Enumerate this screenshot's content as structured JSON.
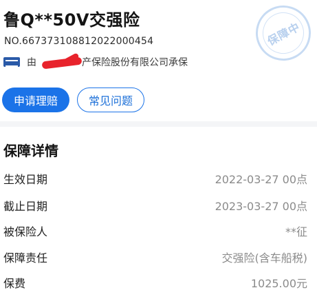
{
  "header": {
    "title": "鲁Q**50V交强险",
    "policy_number": "NO.667373108812022000454",
    "underwriter_prefix": "由",
    "underwriter_suffix": "产保险股份有限公司承保",
    "company_logo_icon": "insurer-logo-icon",
    "stamp_text": "保障中",
    "stamp_color": "#c7dbf3"
  },
  "actions": {
    "claim_label": "申请理赔",
    "faq_label": "常见问题",
    "accent_color": "#1b73e8"
  },
  "details": {
    "section_title": "保障详情",
    "rows": [
      {
        "label": "生效日期",
        "value": "2022-03-27 00点"
      },
      {
        "label": "截止日期",
        "value": "2023-03-27 00点"
      },
      {
        "label": "被保险人",
        "value": "**征"
      },
      {
        "label": "保障责任",
        "value": "交强险(含车船税)"
      },
      {
        "label": "保费",
        "value": "1025.00元"
      }
    ]
  }
}
